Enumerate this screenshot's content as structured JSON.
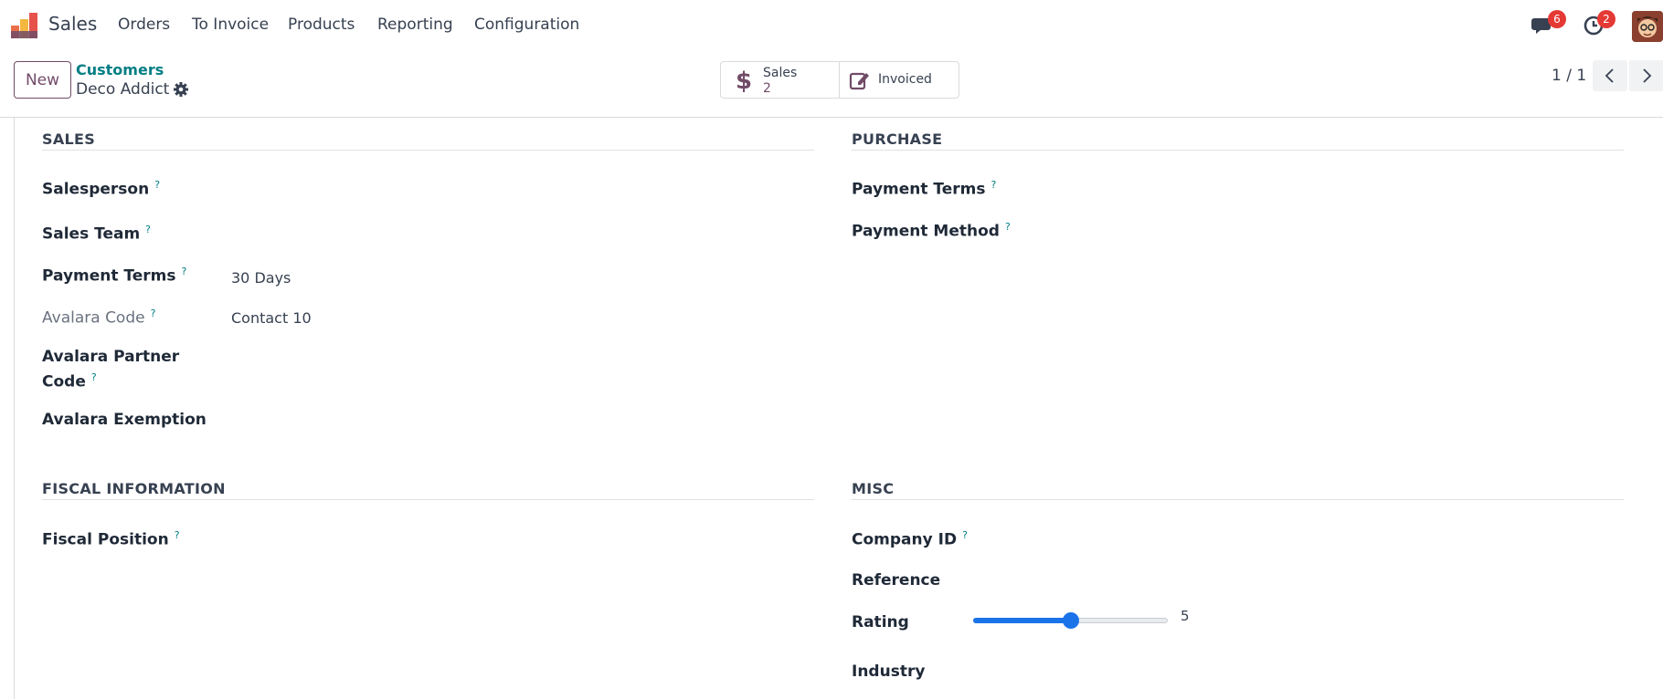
{
  "navbar": {
    "app_name": "Sales",
    "menu": [
      "Orders",
      "To Invoice",
      "Products",
      "Reporting",
      "Configuration"
    ],
    "messages_count": "6",
    "activities_count": "2",
    "icons": {
      "logo": "sales-app-logo",
      "messages": "chat-icon",
      "activities": "clock-icon",
      "avatar": "user-avatar"
    }
  },
  "control": {
    "new_label": "New",
    "breadcrumb_parent": "Customers",
    "breadcrumb_current": "Deco Addict",
    "stat_sales_label": "Sales",
    "stat_sales_value": "2",
    "stat_invoiced_label": "Invoiced",
    "pager": "1 / 1"
  },
  "sales": {
    "title": "SALES",
    "salesperson": "Salesperson",
    "sales_team": "Sales Team",
    "payment_terms": "Payment Terms",
    "payment_terms_value": "30 Days",
    "avalara_code": "Avalara Code",
    "avalara_code_value": "Contact 10",
    "avalara_partner_code_1": "Avalara Partner",
    "avalara_partner_code_2": "Code",
    "avalara_exemption": "Avalara Exemption"
  },
  "purchase": {
    "title": "PURCHASE",
    "payment_terms": "Payment Terms",
    "payment_method": "Payment Method"
  },
  "fiscal": {
    "title": "FISCAL INFORMATION",
    "fiscal_position": "Fiscal Position"
  },
  "misc": {
    "title": "MISC",
    "company_id": "Company ID",
    "reference": "Reference",
    "rating": "Rating",
    "rating_value": "5",
    "rating_fraction": 0.5,
    "industry": "Industry"
  },
  "help_mark": "?",
  "colors": {
    "brand": "#714b67",
    "link": "#017e84",
    "badge": "#e53935",
    "slider": "#1a73e8"
  }
}
